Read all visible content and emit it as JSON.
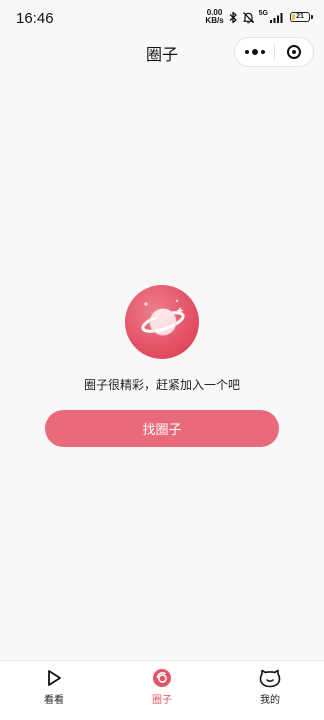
{
  "status_bar": {
    "time": "16:46",
    "net_speed_value": "0.00",
    "net_speed_unit": "KB/s",
    "network_type": "5G",
    "battery": "21",
    "battery_level": 0.21,
    "battery_color": "#f3c545"
  },
  "header": {
    "title": "圈子",
    "more_icon": "more-dots-icon",
    "close_icon": "target-close-icon"
  },
  "empty_state": {
    "illustration": "planet-icon",
    "message": "圈子很精彩，赶紧加入一个吧",
    "button_label": "找圈子"
  },
  "tab_bar": {
    "items": [
      {
        "label": "看看",
        "icon": "play-icon",
        "active": false
      },
      {
        "label": "圈子",
        "icon": "circle-icon",
        "active": true
      },
      {
        "label": "我的",
        "icon": "face-icon",
        "active": false
      }
    ]
  },
  "colors": {
    "accent": "#e45467",
    "button": "#e96a7b",
    "background": "#f8f8f8"
  }
}
